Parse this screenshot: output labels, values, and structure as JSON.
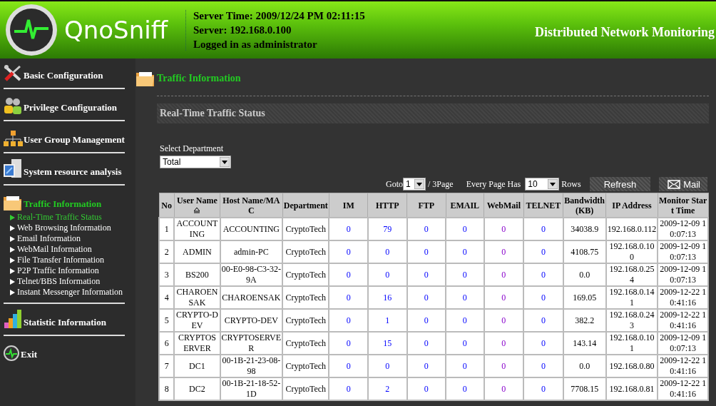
{
  "header": {
    "brand": "QnoSniff",
    "server_time": "Server Time: 2009/12/24 PM 02:11:15",
    "server": "Server: 192.168.0.100",
    "login": "Logged in as administrator",
    "product": "Distributed Network Monitoring"
  },
  "sidebar": {
    "sections": [
      {
        "label": "Basic Configuration",
        "selected": false
      },
      {
        "label": "Privilege Configuration",
        "selected": false
      },
      {
        "label": "User Group Management",
        "selected": false
      },
      {
        "label": "System resource analysis",
        "selected": false
      },
      {
        "label": "Traffic Information",
        "selected": true,
        "children": [
          {
            "label": "Real-Time Traffic Status",
            "selected": true
          },
          {
            "label": "Web Browsing Information",
            "selected": false
          },
          {
            "label": "Email Information",
            "selected": false
          },
          {
            "label": "WebMail Information",
            "selected": false
          },
          {
            "label": "File Transfer Information",
            "selected": false
          },
          {
            "label": "P2P Traffic Information",
            "selected": false
          },
          {
            "label": "Telnet/BBS Information",
            "selected": false
          },
          {
            "label": "Instant Messenger Information",
            "selected": false
          }
        ]
      },
      {
        "label": "Statistic Information",
        "selected": false
      },
      {
        "label": "Exit",
        "selected": false
      }
    ]
  },
  "page": {
    "title": "Traffic Information",
    "section": "Real-Time Traffic Status",
    "department": {
      "label": "Select Department",
      "value": "Total"
    },
    "pager": {
      "goto_label": "Goto",
      "page": "1",
      "page_total": "/ 3Page",
      "per_page_label": "Every Page Has",
      "per_page": "10",
      "rows_label": "Rows"
    },
    "buttons": [
      {
        "label": "Refresh",
        "kind": "plain"
      },
      {
        "label": "Mail",
        "kind": "mail"
      }
    ]
  },
  "table": {
    "columns": [
      {
        "label": "No",
        "kind": "text",
        "sorted": false
      },
      {
        "label": "User Name",
        "kind": "text",
        "sorted": true
      },
      {
        "label": "Host Name/MAC",
        "kind": "text",
        "sorted": false
      },
      {
        "label": "Department",
        "kind": "text",
        "sorted": false
      },
      {
        "label": "IM",
        "kind": "count",
        "sorted": false
      },
      {
        "label": "HTTP",
        "kind": "count",
        "sorted": false
      },
      {
        "label": "FTP",
        "kind": "count",
        "sorted": false
      },
      {
        "label": "EMAIL",
        "kind": "count",
        "sorted": false
      },
      {
        "label": "WebMail",
        "kind": "visited",
        "sorted": false
      },
      {
        "label": "TELNET",
        "kind": "count",
        "sorted": false
      },
      {
        "label": "Bandwidth (KB)",
        "kind": "text",
        "sorted": false
      },
      {
        "label": "IP Address",
        "kind": "text",
        "sorted": false
      },
      {
        "label": "Monitor Start Time",
        "kind": "text",
        "sorted": false
      }
    ],
    "rows": [
      [
        "1",
        "ACCOUNTING",
        "ACCOUNTING",
        "CryptoTech",
        "0",
        "79",
        "0",
        "0",
        "0",
        "0",
        "34038.9",
        "192.168.0.112",
        "2009-12-09 10:07:13"
      ],
      [
        "2",
        "ADMIN",
        "admin-PC",
        "CryptoTech",
        "0",
        "0",
        "0",
        "0",
        "0",
        "0",
        "4108.75",
        "192.168.0.100",
        "2009-12-09 10:07:13"
      ],
      [
        "3",
        "BS200",
        "00-E0-98-C3-32-9A",
        "CryptoTech",
        "0",
        "0",
        "0",
        "0",
        "0",
        "0",
        "0.0",
        "192.168.0.254",
        "2009-12-09 10:07:13"
      ],
      [
        "4",
        "CHAROENSAK",
        "CHAROENSAK",
        "CryptoTech",
        "0",
        "16",
        "0",
        "0",
        "0",
        "0",
        "169.05",
        "192.168.0.141",
        "2009-12-22 10:41:16"
      ],
      [
        "5",
        "CRYPTO-DEV",
        "CRYPTO-DEV",
        "CryptoTech",
        "0",
        "1",
        "0",
        "0",
        "0",
        "0",
        "382.2",
        "192.168.0.243",
        "2009-12-22 10:41:16"
      ],
      [
        "6",
        "CRYPTOSERVER",
        "CRYPTOSERVER",
        "CryptoTech",
        "0",
        "15",
        "0",
        "0",
        "0",
        "0",
        "143.14",
        "192.168.0.101",
        "2009-12-09 10:07:13"
      ],
      [
        "7",
        "DC1",
        "00-1B-21-23-08-98",
        "CryptoTech",
        "0",
        "0",
        "0",
        "0",
        "0",
        "0",
        "0.0",
        "192.168.0.80",
        "2009-12-22 10:41:16"
      ],
      [
        "8",
        "DC2",
        "00-1B-21-18-52-1D",
        "CryptoTech",
        "0",
        "2",
        "0",
        "0",
        "0",
        "0",
        "7708.15",
        "192.168.0.81",
        "2009-12-22 10:41:16"
      ]
    ]
  }
}
